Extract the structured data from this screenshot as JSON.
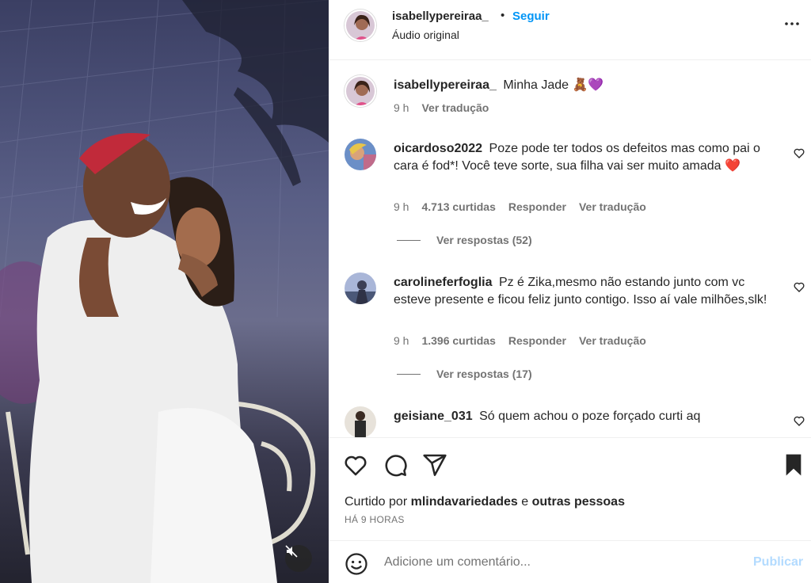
{
  "post": {
    "author": "isabellypereiraa_",
    "follow_label": "Seguir",
    "audio_label": "Áudio original",
    "dot": "•"
  },
  "caption": {
    "username": "isabellypereiraa_",
    "text": "Minha Jade",
    "emoji": "🧸💜",
    "time": "9 h",
    "translate": "Ver tradução"
  },
  "comments": [
    {
      "username": "oicardoso2022",
      "text": "Poze pode ter todos os defeitos mas como pai o cara é fod*! Você teve sorte, sua filha vai ser muito amada",
      "emoji": "❤️",
      "time": "9 h",
      "likes": "4.713 curtidas",
      "reply": "Responder",
      "translate": "Ver tradução",
      "view_replies": "Ver respostas (52)"
    },
    {
      "username": "carolineferfoglia",
      "text": "Pz é Zika,mesmo não estando junto com vc esteve presente e ficou feliz junto contigo. Isso aí vale milhões,slk!",
      "time": "9 h",
      "likes": "1.396 curtidas",
      "reply": "Responder",
      "translate": "Ver tradução",
      "view_replies": "Ver respostas (17)"
    },
    {
      "username": "geisiane_031",
      "text": "Só quem achou o poze forçado curti aq"
    }
  ],
  "footer": {
    "liked_prefix": "Curtido por",
    "liked_user": "mlindavariedades",
    "liked_and": "e",
    "liked_others": "outras pessoas",
    "time_ago": "HÁ 9 HORAS",
    "comment_placeholder": "Adicione um comentário...",
    "publish_label": "Publicar"
  },
  "icons": {
    "more": "more-icon",
    "heart": "heart-icon",
    "comment": "comment-icon",
    "share": "share-icon",
    "save": "bookmark-icon",
    "emoji": "emoji-icon",
    "mute": "muted-speaker-icon"
  },
  "colors": {
    "accent": "#0095f6",
    "publish_disabled": "#b3dbff",
    "secondary_text": "#737373",
    "heart_red": "#ed4956"
  }
}
